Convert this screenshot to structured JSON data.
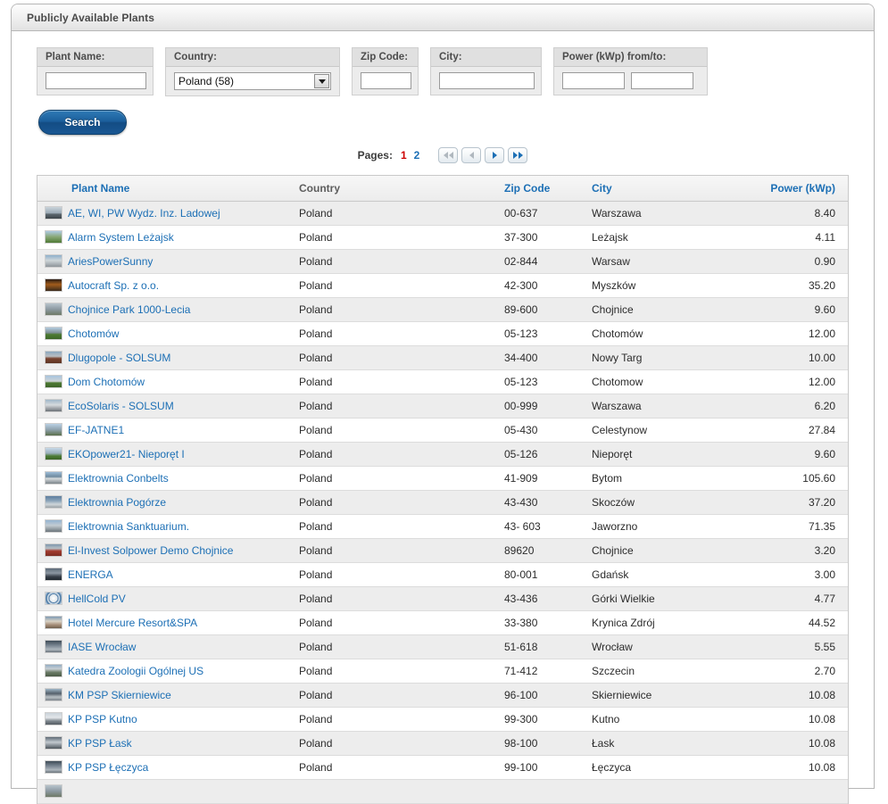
{
  "panel": {
    "title": "Publicly Available Plants"
  },
  "search": {
    "fields": {
      "plant_name": {
        "label": "Plant Name:",
        "value": ""
      },
      "country": {
        "label": "Country:",
        "value": "Poland (58)"
      },
      "zip_code": {
        "label": "Zip Code:",
        "value": ""
      },
      "city": {
        "label": "City:",
        "value": ""
      },
      "power": {
        "label": "Power (kWp) from/to:",
        "from": "",
        "to": ""
      }
    },
    "button_label": "Search"
  },
  "pager": {
    "label": "Pages:",
    "pages": [
      "1",
      "2"
    ],
    "current": "1",
    "buttons": [
      "first-page",
      "previous-page",
      "next-page",
      "last-page"
    ]
  },
  "table": {
    "columns": [
      "Plant Name",
      "Country",
      "Zip Code",
      "City",
      "Power (kWp)"
    ],
    "rows": [
      {
        "thumb": "t1",
        "name": "AE, WI, PW Wydz. Inz. Ladowej",
        "country": "Poland",
        "zip": "00-637",
        "city": "Warszawa",
        "power": "8.40"
      },
      {
        "thumb": "t2",
        "name": "Alarm System Leżajsk",
        "country": "Poland",
        "zip": "37-300",
        "city": "Leżajsk",
        "power": "4.11"
      },
      {
        "thumb": "t3",
        "name": "AriesPowerSunny",
        "country": "Poland",
        "zip": "02-844",
        "city": "Warsaw",
        "power": "0.90"
      },
      {
        "thumb": "t4",
        "name": "Autocraft Sp. z o.o.",
        "country": "Poland",
        "zip": "42-300",
        "city": "Myszków",
        "power": "35.20"
      },
      {
        "thumb": "t5",
        "name": "Chojnice Park 1000-Lecia",
        "country": "Poland",
        "zip": "89-600",
        "city": "Chojnice",
        "power": "9.60"
      },
      {
        "thumb": "t6",
        "name": "Chotomów",
        "country": "Poland",
        "zip": "05-123",
        "city": "Chotomów",
        "power": "12.00"
      },
      {
        "thumb": "t7",
        "name": "Dlugopole - SOLSUM",
        "country": "Poland",
        "zip": "34-400",
        "city": "Nowy Targ",
        "power": "10.00"
      },
      {
        "thumb": "t8",
        "name": "Dom Chotomów",
        "country": "Poland",
        "zip": "05-123",
        "city": "Chotomow",
        "power": "12.00"
      },
      {
        "thumb": "t9",
        "name": "EcoSolaris - SOLSUM",
        "country": "Poland",
        "zip": "00-999",
        "city": "Warszawa",
        "power": "6.20"
      },
      {
        "thumb": "t10",
        "name": "EF-JATNE1",
        "country": "Poland",
        "zip": "05-430",
        "city": "Celestynow",
        "power": "27.84"
      },
      {
        "thumb": "t11",
        "name": "EKOpower21- Nieporęt I",
        "country": "Poland",
        "zip": "05-126",
        "city": "Nieporęt",
        "power": "9.60"
      },
      {
        "thumb": "t12",
        "name": "Elektrownia Conbelts",
        "country": "Poland",
        "zip": "41-909",
        "city": "Bytom",
        "power": "105.60"
      },
      {
        "thumb": "t13",
        "name": "Elektrownia Pogórze",
        "country": "Poland",
        "zip": "43-430",
        "city": "Skoczów",
        "power": "37.20"
      },
      {
        "thumb": "t15",
        "name": "Elektrownia Sanktuarium.",
        "country": "Poland",
        "zip": "43- 603",
        "city": "Jaworzno",
        "power": "71.35"
      },
      {
        "thumb": "t14",
        "name": "El-Invest Solpower Demo Chojnice",
        "country": "Poland",
        "zip": "89620",
        "city": "Chojnice",
        "power": "3.20"
      },
      {
        "thumb": "t18",
        "name": "ENERGA",
        "country": "Poland",
        "zip": "80-001",
        "city": "Gdańsk",
        "power": "3.00"
      },
      {
        "thumb": "t16",
        "name": "HellCold PV",
        "country": "Poland",
        "zip": "43-436",
        "city": "Górki Wielkie",
        "power": "4.77"
      },
      {
        "thumb": "t17",
        "name": "Hotel Mercure Resort&SPA",
        "country": "Poland",
        "zip": "33-380",
        "city": "Krynica Zdrój",
        "power": "44.52"
      },
      {
        "thumb": "t20",
        "name": "IASE Wrocław",
        "country": "Poland",
        "zip": "51-618",
        "city": "Wrocław",
        "power": "5.55"
      },
      {
        "thumb": "t19",
        "name": "Katedra Zoologii Ogólnej US",
        "country": "Poland",
        "zip": "71-412",
        "city": "Szczecin",
        "power": "2.70"
      },
      {
        "thumb": "t22",
        "name": "KM PSP Skierniewice",
        "country": "Poland",
        "zip": "96-100",
        "city": "Skierniewice",
        "power": "10.08"
      },
      {
        "thumb": "t21",
        "name": "KP PSP Kutno",
        "country": "Poland",
        "zip": "99-300",
        "city": "Kutno",
        "power": "10.08"
      },
      {
        "thumb": "t23",
        "name": "KP PSP Łask",
        "country": "Poland",
        "zip": "98-100",
        "city": "Łask",
        "power": "10.08"
      },
      {
        "thumb": "t20",
        "name": "KP PSP Łęczyca",
        "country": "Poland",
        "zip": "99-100",
        "city": "Łęczyca",
        "power": "10.08"
      },
      {
        "thumb": "t5",
        "name": "",
        "country": "",
        "zip": "",
        "city": "",
        "power": ""
      }
    ]
  }
}
